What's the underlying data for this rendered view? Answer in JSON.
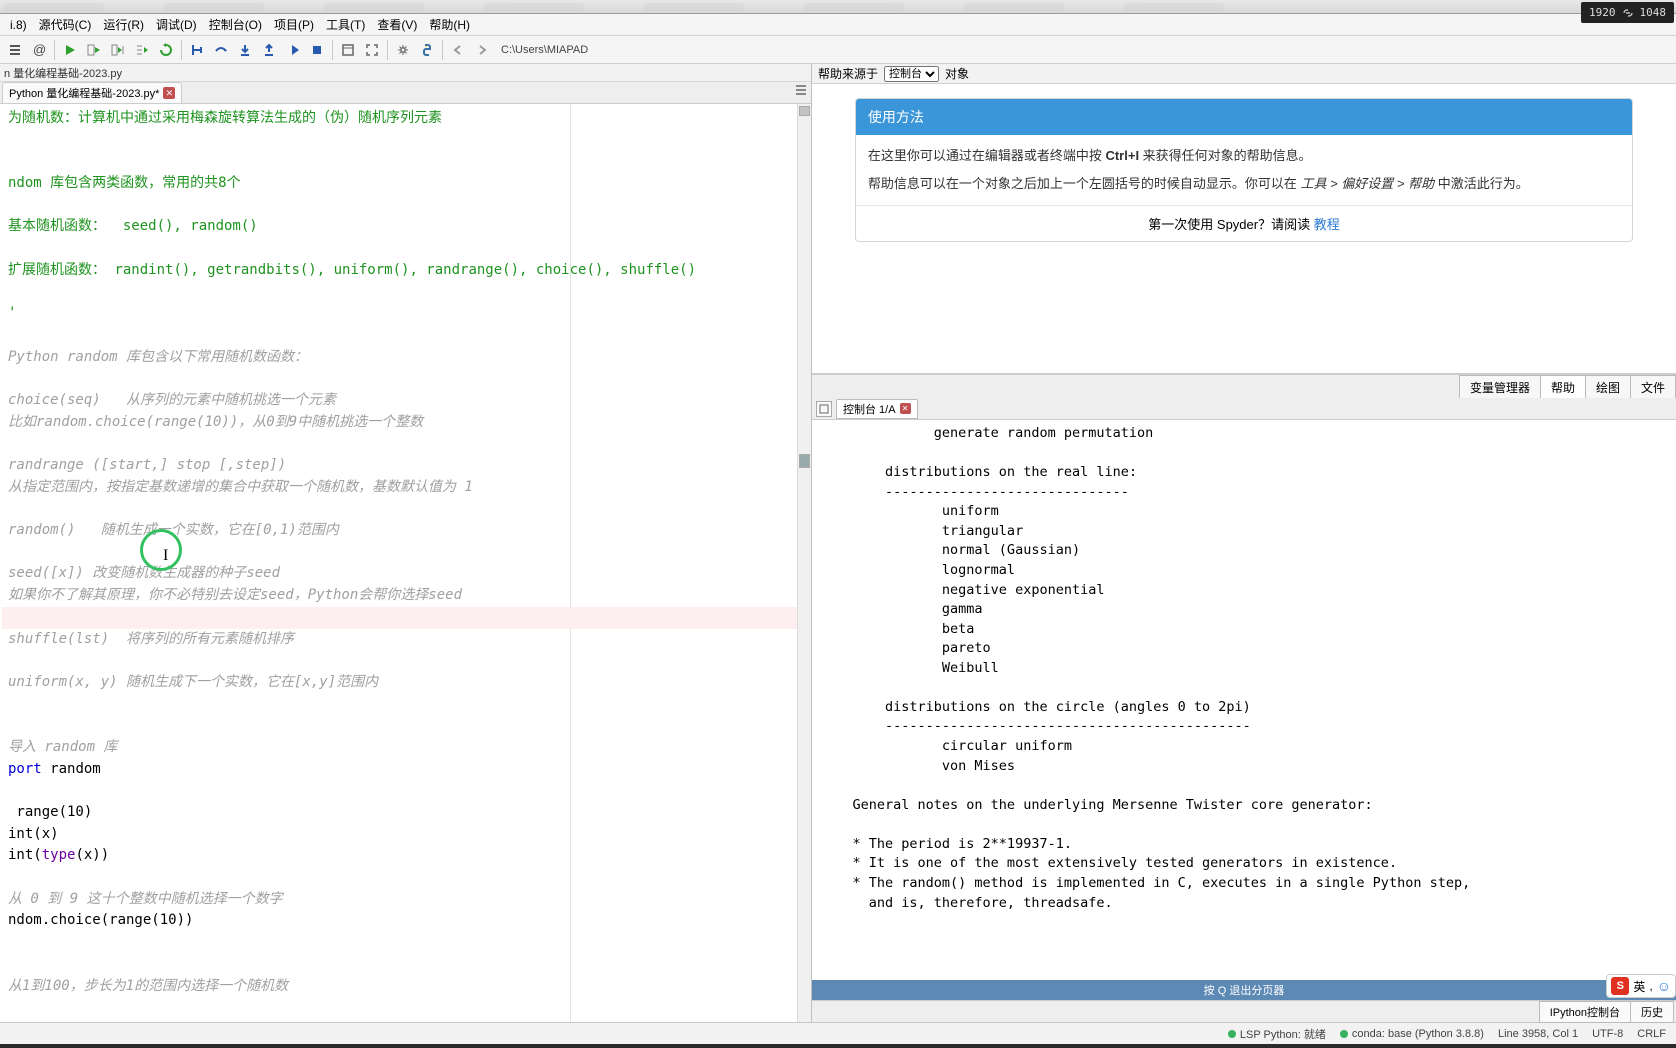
{
  "resolution": {
    "w": "1920",
    "h": "1048"
  },
  "menus": {
    "file": "i.8)",
    "m1": "源代码(C)",
    "m2": "运行(R)",
    "m3": "调试(D)",
    "m4": "控制台(O)",
    "m5": "项目(P)",
    "m6": "工具(T)",
    "m7": "查看(V)",
    "m8": "帮助(H)"
  },
  "path": "C:\\Users\\MIAPAD",
  "editor_path": "n 量化编程基础-2023.py",
  "editor_tab": "Python 量化编程基础-2023.py*",
  "code": {
    "l1": "为随机数：计算机中通过采用梅森旋转算法生成的（伪）随机序列元素",
    "l2": "ndom 库包含两类函数，常用的共8个",
    "l3a": "基本随机函数：  ",
    "l3b": "seed(), random()",
    "l4a": "扩展随机函数： ",
    "l4b": "randint(), getrandbits(), uniform(), randrange(), choice(), shuffle()",
    "l5": "Python random 库包含以下常用随机数函数：",
    "l6": "choice(seq)   从序列的元素中随机挑选一个元素",
    "l7": "比如random.choice(range(10))，从0到9中随机挑选一个整数",
    "l8": "randrange ([start,] stop [,step])",
    "l9": "从指定范围内，按指定基数递增的集合中获取一个随机数，基数默认值为 1",
    "l10": "random()   随机生成一个实数，它在[0,1)范围内",
    "l11": "seed([x]) 改变随机数生成器的种子seed",
    "l12": "如果你不了解其原理，你不必特别去设定seed，Python会帮你选择seed",
    "l13": "shuffle(lst)  将序列的所有元素随机排序",
    "l14": "uniform(x, y) 随机生成下一个实数，它在[x,y]范围内",
    "l15": "导入 random 库",
    "imp_k": "port ",
    "imp_m": "random",
    "r1": " range(10)",
    "r2": "int(x)",
    "r3a": "int(",
    "r3b": "type",
    "r3c": "(x))",
    "l16": "从 0 到 9 这十个整数中随机选择一个数字",
    "ch1": "ndom.choice(range(10))",
    "l17": "从1到100，步长为1的范围内选择一个随机数"
  },
  "help": {
    "src_label": "帮助来源于",
    "src_val": "控制台",
    "obj": "对象",
    "title": "使用方法",
    "line1a": "在这里你可以通过在编辑器或者终端中按 ",
    "line1b": "Ctrl+I",
    "line1c": " 来获得任何对象的帮助信息。",
    "line2a": "帮助信息可以在一个对象之后加上一个左圆括号的时候自动显示。你可以在 ",
    "line2b": "工具 > 偏好设置 > 帮助",
    "line2c": " 中激活此行为。",
    "footer": "第一次使用 Spyder？请阅读 ",
    "tutorial": "教程"
  },
  "right_tabs": {
    "t1": "变量管理器",
    "t2": "帮助",
    "t3": "绘图",
    "t4": "文件"
  },
  "console": {
    "tab": "控制台 1/A",
    "body": "              generate random permutation\n\n        distributions on the real line:\n        ------------------------------\n               uniform\n               triangular\n               normal (Gaussian)\n               lognormal\n               negative exponential\n               gamma\n               beta\n               pareto\n               Weibull\n\n        distributions on the circle (angles 0 to 2pi)\n        ---------------------------------------------\n               circular uniform\n               von Mises\n\n    General notes on the underlying Mersenne Twister core generator:\n\n    * The period is 2**19937-1.\n    * It is one of the most extensively tested generators in existence.\n    * The random() method is implemented in C, executes in a single Python step,\n      and is, therefore, threadsafe.",
    "pager": "按 Q 退出分页器",
    "bt1": "IPython控制台",
    "bt2": "历史"
  },
  "status": {
    "lsp": "LSP Python: 就绪",
    "conda": "conda: base (Python 3.8.8)",
    "pos": "Line 3958, Col 1",
    "enc": "UTF-8",
    "eol": "CRLF"
  },
  "ime": {
    "lang": "英",
    "sep": ","
  }
}
